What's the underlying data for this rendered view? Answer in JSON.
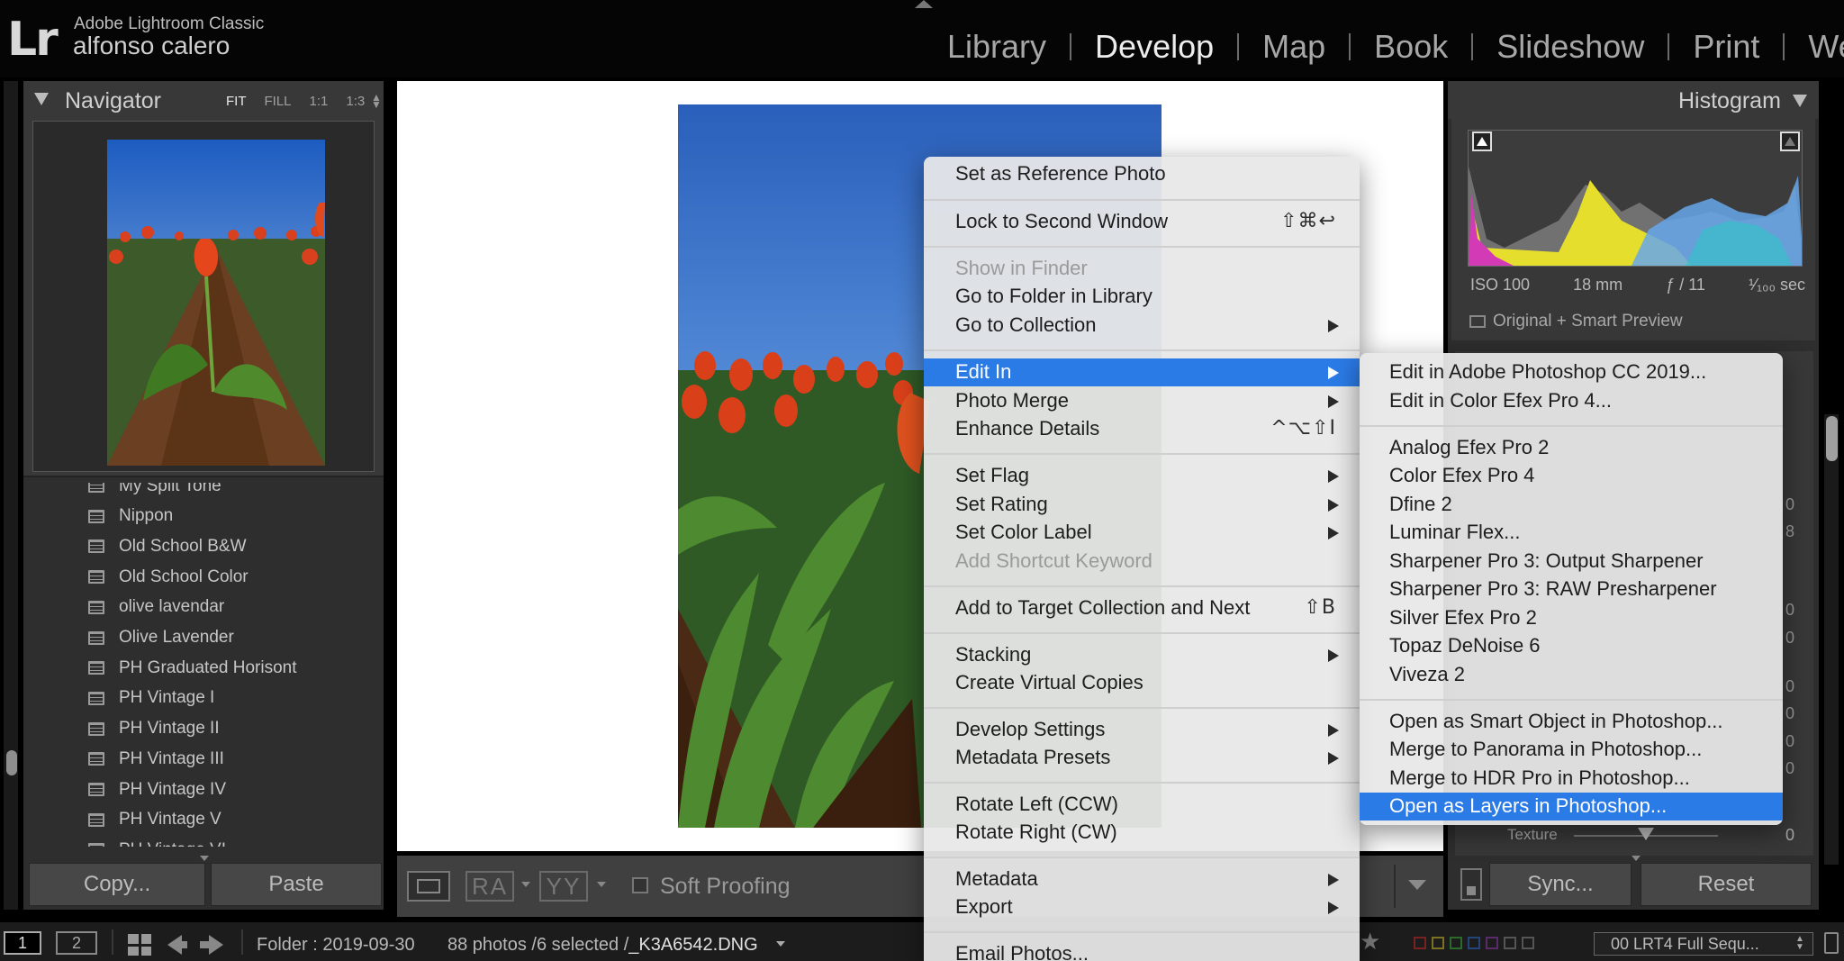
{
  "app": {
    "logo": "Lr",
    "name": "Adobe Lightroom Classic",
    "user": "alfonso calero"
  },
  "modules": [
    {
      "label": "Library",
      "active": false
    },
    {
      "label": "Develop",
      "active": true
    },
    {
      "label": "Map",
      "active": false
    },
    {
      "label": "Book",
      "active": false
    },
    {
      "label": "Slideshow",
      "active": false
    },
    {
      "label": "Print",
      "active": false
    },
    {
      "label": "Web",
      "active": false
    }
  ],
  "navigator": {
    "title": "Navigator",
    "zoom": [
      "FIT",
      "FILL",
      "1:1",
      "1:3"
    ],
    "zoom_active": "FIT"
  },
  "presets": [
    "My Split Tone",
    "Nippon",
    "Old School B&W",
    "Old School Color",
    "olive lavendar",
    "Olive Lavender",
    "PH Graduated Horisont",
    "PH Vintage I",
    "PH Vintage II",
    "PH Vintage III",
    "PH Vintage IV",
    "PH Vintage V",
    "PH Vintage VI"
  ],
  "left_buttons": {
    "copy": "Copy...",
    "paste": "Paste"
  },
  "toolbar": {
    "ra": "RA",
    "yy": "YY",
    "soft_proofing": "Soft Proofing"
  },
  "histogram": {
    "title": "Histogram",
    "iso": "ISO 100",
    "focal": "18 mm",
    "aperture": "ƒ / 11",
    "shutter": "¹⁄₁₀₀ sec",
    "preview": "Original + Smart Preview"
  },
  "right_panel": {
    "buried_values": [
      "0",
      "8",
      "0",
      "0",
      "0",
      "0",
      "0",
      "0"
    ],
    "texture_label": "Texture",
    "texture_value": "0",
    "texture_level": 0.5
  },
  "right_buttons": {
    "sync": "Sync...",
    "reset": "Reset"
  },
  "filmstrip": {
    "screen1": "1",
    "screen2": "2",
    "folder": "Folder : 2019-09-30",
    "count_prefix": "88 photos /6 selected /",
    "filename": "_K3A6542.DNG",
    "sequence": "00 LRT4 Full Sequ..."
  },
  "context_menu": {
    "items": [
      {
        "label": "Set as Reference Photo"
      },
      {
        "label": "Lock to Second Window",
        "shortcut": "⇧⌘↩"
      },
      {
        "label": "Show in Finder",
        "disabled": true
      },
      {
        "label": "Go to Folder in Library"
      },
      {
        "label": "Go to Collection",
        "submenu": true
      },
      {
        "label": "Edit In",
        "submenu": true,
        "highlighted": true
      },
      {
        "label": "Photo Merge",
        "submenu": true
      },
      {
        "label": "Enhance Details",
        "shortcut": "^⌥⇧I"
      },
      {
        "label": "Set Flag",
        "submenu": true
      },
      {
        "label": "Set Rating",
        "submenu": true
      },
      {
        "label": "Set Color Label",
        "submenu": true
      },
      {
        "label": "Add Shortcut Keyword",
        "disabled": true
      },
      {
        "label": "Add to Target Collection and Next",
        "shortcut": "⇧B"
      },
      {
        "label": "Stacking",
        "submenu": true
      },
      {
        "label": "Create Virtual Copies"
      },
      {
        "label": "Develop Settings",
        "submenu": true
      },
      {
        "label": "Metadata Presets",
        "submenu": true
      },
      {
        "label": "Rotate Left (CCW)"
      },
      {
        "label": "Rotate Right (CW)"
      },
      {
        "label": "Metadata",
        "submenu": true
      },
      {
        "label": "Export",
        "submenu": true
      },
      {
        "label": "Email Photos..."
      }
    ]
  },
  "edit_in_menu": {
    "items": [
      {
        "label": "Edit in Adobe Photoshop CC 2019..."
      },
      {
        "label": "Edit in Color Efex Pro 4..."
      },
      {
        "label": "Analog Efex Pro 2"
      },
      {
        "label": "Color Efex Pro 4"
      },
      {
        "label": "Dfine 2"
      },
      {
        "label": "Luminar Flex..."
      },
      {
        "label": "Sharpener Pro 3: Output Sharpener"
      },
      {
        "label": "Sharpener Pro 3: RAW Presharpener"
      },
      {
        "label": "Silver Efex Pro 2"
      },
      {
        "label": "Topaz DeNoise 6"
      },
      {
        "label": "Viveza 2"
      },
      {
        "label": "Open as Smart Object in Photoshop..."
      },
      {
        "label": "Merge to Panorama in Photoshop..."
      },
      {
        "label": "Merge to HDR Pro in Photoshop..."
      },
      {
        "label": "Open as Layers in Photoshop...",
        "highlighted": true
      }
    ]
  },
  "colors": {
    "accent": "#2b7be7",
    "menu_bg": "#e8e8e8",
    "panel_bg": "#2e2e2e"
  }
}
